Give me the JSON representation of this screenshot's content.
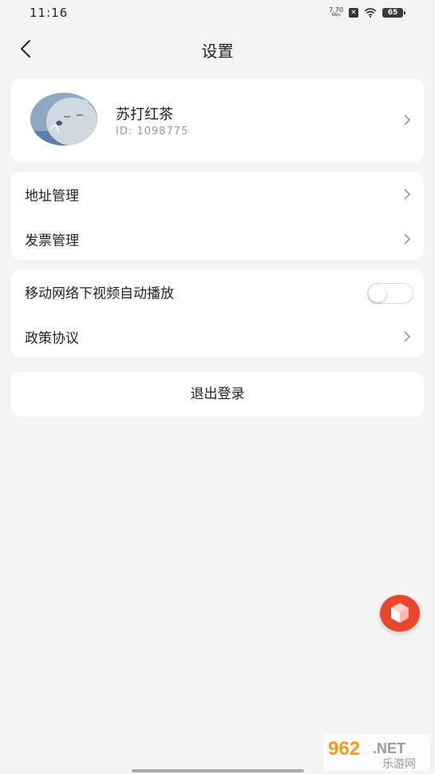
{
  "status_bar": {
    "time": "11:16",
    "net_speed_value": "7.70",
    "net_speed_unit": "KB/s",
    "battery": "65",
    "icons": [
      "xbox-icon",
      "wifi-icon",
      "battery-icon"
    ]
  },
  "nav": {
    "title": "设置",
    "back_icon": "chevron-left-icon"
  },
  "profile": {
    "name": "苏打红茶",
    "id_text": "ID: 1098775",
    "chevron_icon": "chevron-right-icon"
  },
  "group1": {
    "items": [
      {
        "label": "地址管理"
      },
      {
        "label": "发票管理"
      }
    ]
  },
  "group2": {
    "autoplay_label": "移动网络下视频自动播放",
    "autoplay_on": false,
    "policy_label": "政策协议"
  },
  "logout": {
    "label": "退出登录"
  },
  "fab": {
    "icon": "cube-icon",
    "color": "#e8472c"
  },
  "watermark": {
    "brand": "962",
    "suffix": ".NET",
    "subtitle": "乐游网"
  },
  "colors": {
    "background": "#f4f4f4",
    "card": "#ffffff",
    "accent": "#e8472c"
  }
}
